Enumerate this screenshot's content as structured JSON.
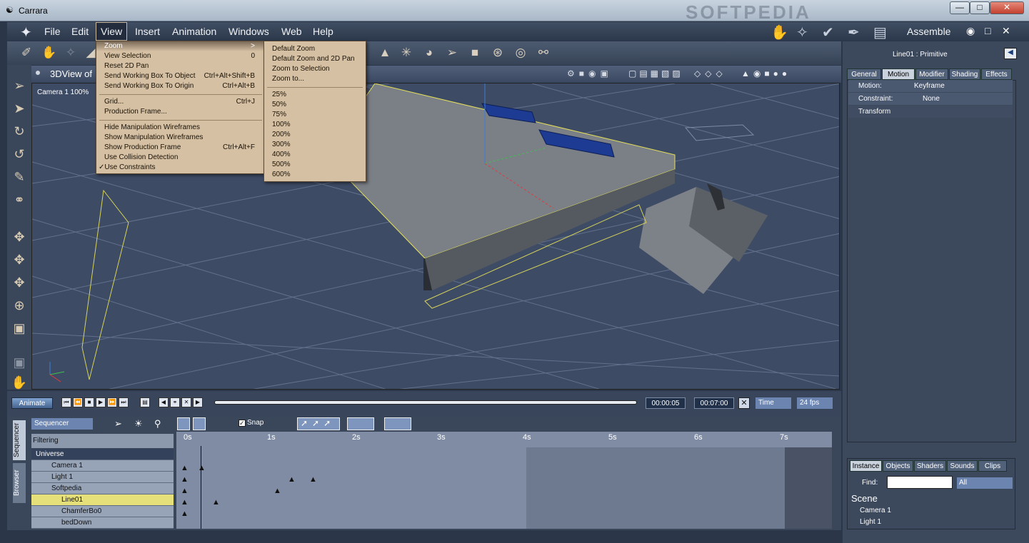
{
  "window": {
    "title": "Carrara",
    "watermark": "SOFTPEDIA"
  },
  "menu": [
    "File",
    "Edit",
    "View",
    "Insert",
    "Animation",
    "Windows",
    "Web",
    "Help"
  ],
  "room": "Assemble",
  "view_menu": {
    "items": [
      {
        "label": "Zoom",
        "key": ">",
        "hot": true
      },
      {
        "label": "View Selection",
        "key": "0"
      },
      {
        "label": "Reset 2D Pan",
        "key": ""
      },
      {
        "label": "Send Working Box To Object",
        "key": "Ctrl+Alt+Shift+B"
      },
      {
        "label": "Send Working Box To Origin",
        "key": "Ctrl+Alt+B"
      },
      {
        "label": "Grid...",
        "key": "Ctrl+J"
      },
      {
        "label": "Production Frame...",
        "key": ""
      },
      {
        "label": "Hide Manipulation Wireframes",
        "key": ""
      },
      {
        "label": "Show Manipulation Wireframes",
        "key": ""
      },
      {
        "label": "Show Production Frame",
        "key": "Ctrl+Alt+F"
      },
      {
        "label": "Use Collision Detection",
        "key": ""
      },
      {
        "label": "✓Use Constraints",
        "key": ""
      }
    ]
  },
  "zoom_menu": [
    "Default Zoom",
    "Default Zoom and 2D Pan",
    "Zoom to Selection",
    "Zoom to...",
    "25%",
    "50%",
    "75%",
    "100%",
    "200%",
    "300%",
    "400%",
    "500%",
    "600%"
  ],
  "view": {
    "title": "3DView of",
    "camera": "Camera 1 100%"
  },
  "properties": {
    "title": "Line01 : Primitive",
    "tabs": [
      "General",
      "Motion",
      "Modifier",
      "Shading",
      "Effects"
    ],
    "motion_label": "Motion:",
    "motion_value": "Keyframe",
    "constraint_label": "Constraint:",
    "constraint_value": "None",
    "transform_label": "Transform"
  },
  "browser": {
    "tabs": [
      "Instance",
      "Objects",
      "Shaders",
      "Sounds",
      "Clips"
    ],
    "find_label": "Find:",
    "filter": "All",
    "scene_label": "Scene",
    "items": [
      "Camera 1",
      "Light 1"
    ]
  },
  "timeline": {
    "animate": "Animate",
    "current_time": "00:00:05",
    "total_time": "00:07:00",
    "time_mode": "Time",
    "fps": "24 fps"
  },
  "sequencer": {
    "mode": "Sequencer",
    "snap": "Snap",
    "filtering": "Filtering",
    "side_tabs": [
      "Sequencer",
      "Browser"
    ],
    "rows": [
      "Universe",
      "Camera 1",
      "Light 1",
      "Softpedia",
      "Line01",
      "ChamferBo0",
      "bedDown"
    ],
    "ruler": [
      "0s",
      "1s",
      "2s",
      "3s",
      "4s",
      "5s",
      "6s",
      "7s"
    ]
  }
}
